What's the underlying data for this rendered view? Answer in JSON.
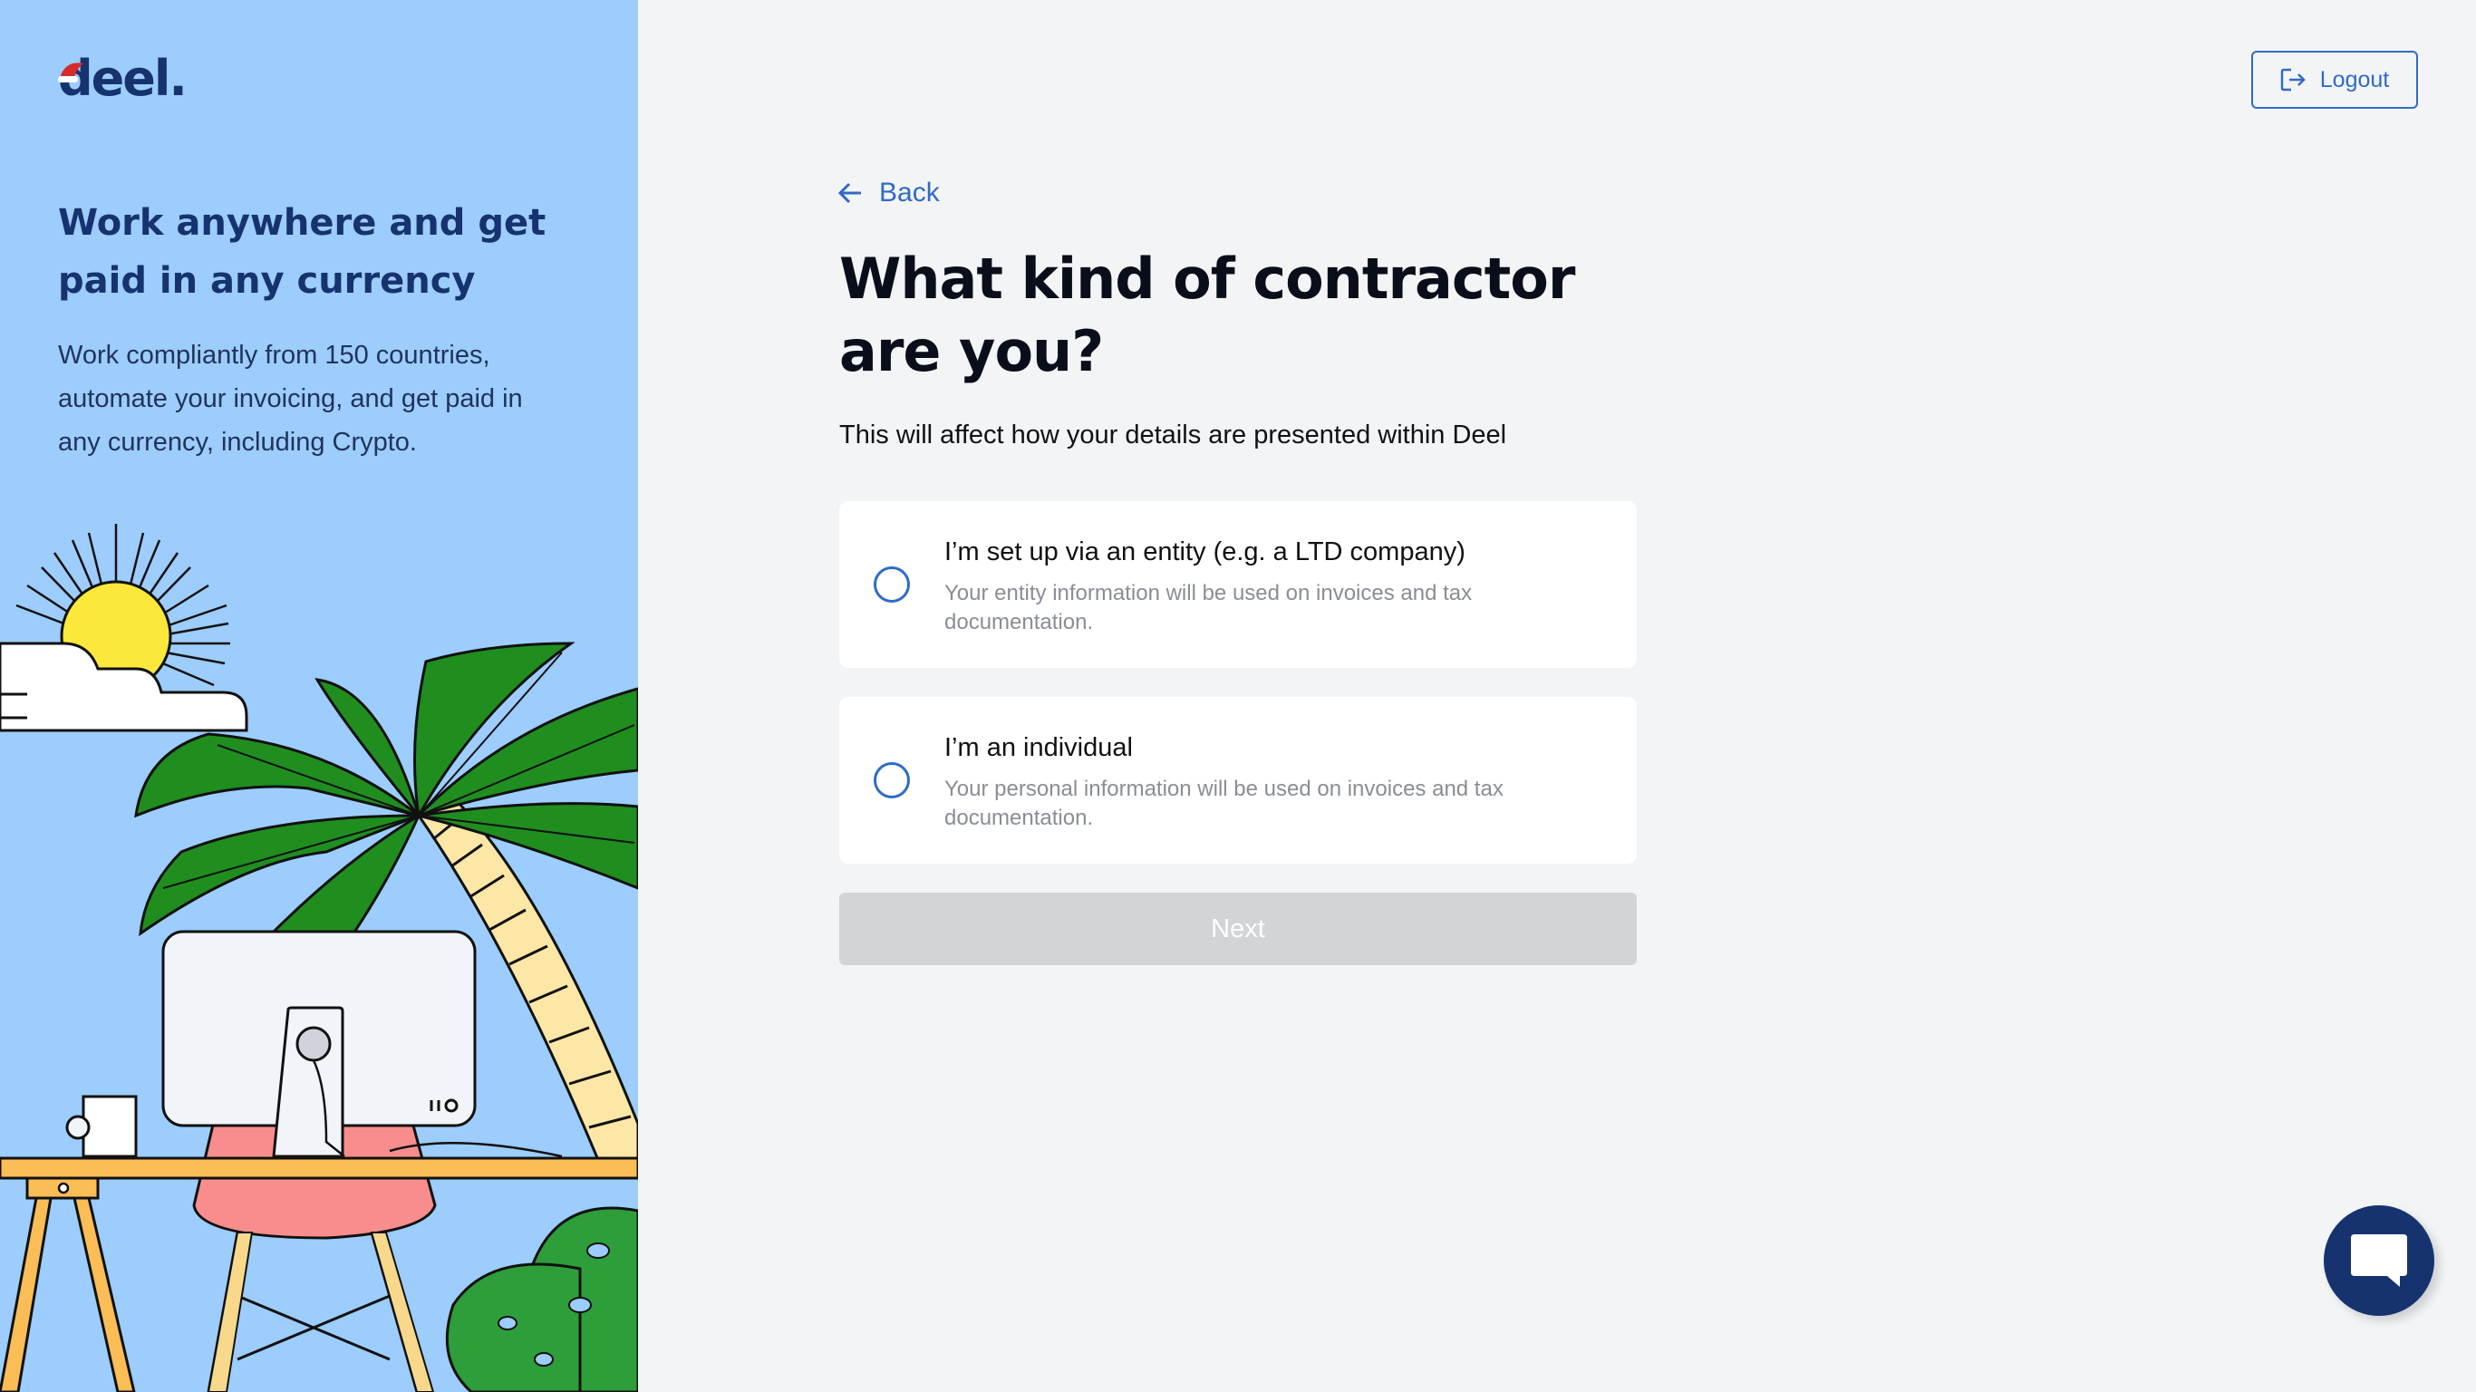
{
  "brand": {
    "logo_text": "deel.",
    "navy": "#16336f",
    "accent": "#2f6bc6",
    "panel_bg": "#9ccdfc"
  },
  "left_panel": {
    "headline": "Work anywhere and get paid in any currency",
    "subtext": "Work compliantly from 150 countries, automate your invoicing, and get paid in any currency, including Crypto."
  },
  "header": {
    "logout_label": "Logout",
    "logout_icon": "logout-icon"
  },
  "nav": {
    "back_label": "Back",
    "back_icon": "arrow-left-icon"
  },
  "main": {
    "title": "What kind of contractor are you?",
    "description": "This will affect how your details are presented within Deel",
    "options": [
      {
        "title": "I’m set up via an entity (e.g. a LTD company)",
        "description": "Your entity information will be used on invoices and tax documentation.",
        "selected": false
      },
      {
        "title": "I’m an individual",
        "description": "Your personal information will be used on invoices and tax documentation.",
        "selected": false
      }
    ],
    "next_label": "Next",
    "next_enabled": false
  },
  "chat": {
    "icon": "chat-bubble-icon"
  }
}
